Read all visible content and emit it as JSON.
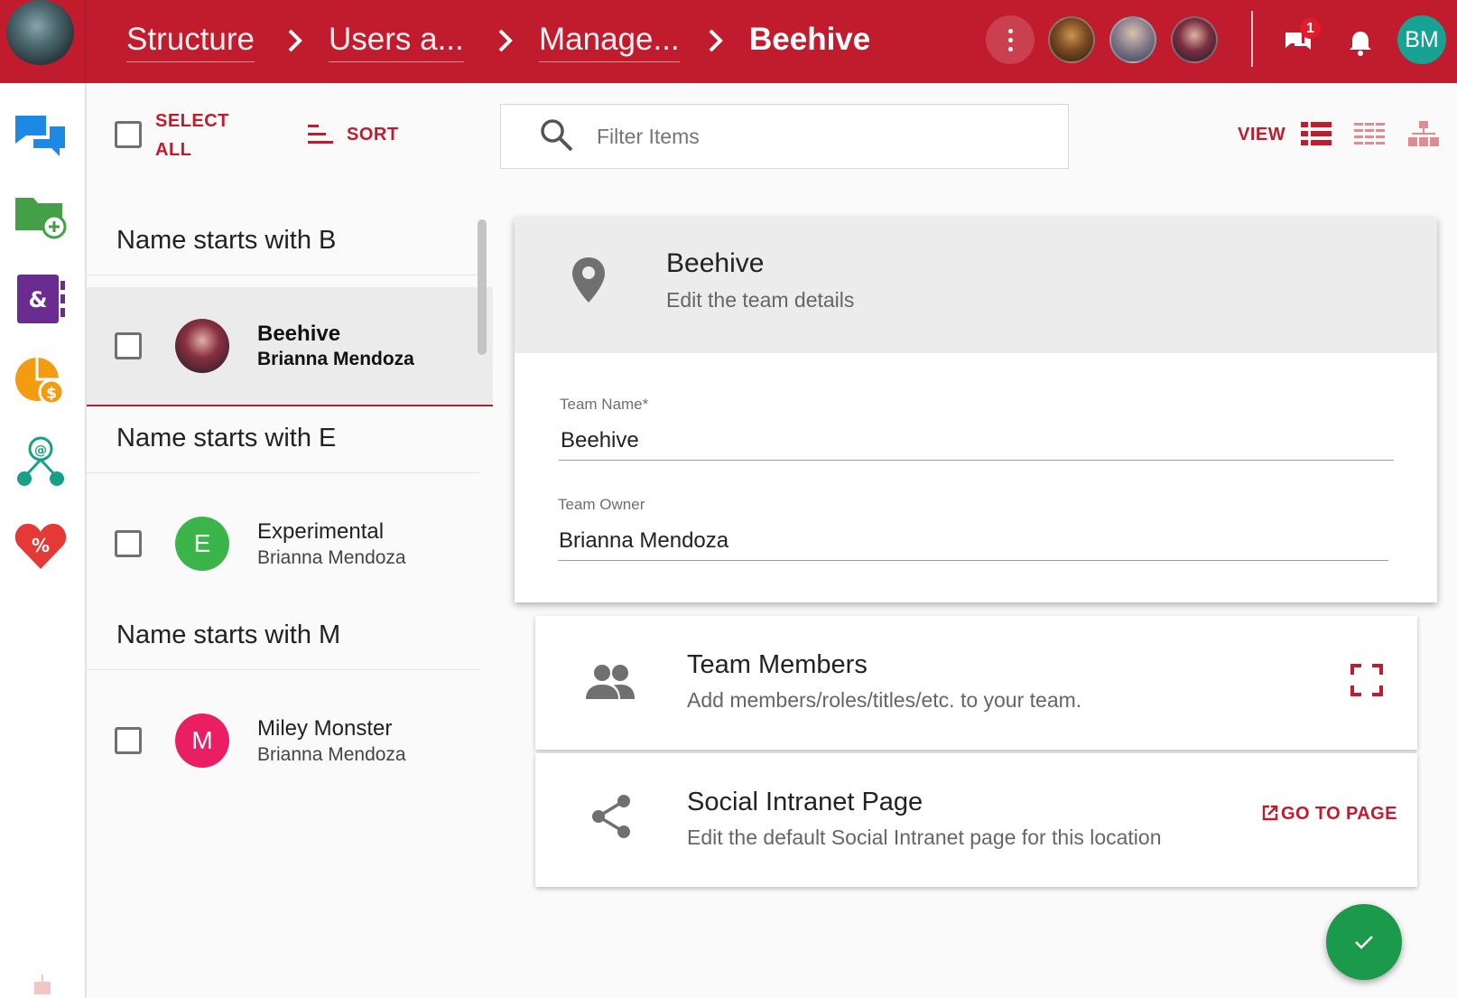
{
  "header": {
    "breadcrumbs": [
      "Structure",
      "Users a...",
      "Manage...",
      "Beehive"
    ],
    "notification_count": "1",
    "user_initials": "BM",
    "colors": {
      "brand": "#c01c2e",
      "badge": "#e51a2b",
      "user_avatar": "#17a394"
    }
  },
  "sidebar": {
    "items": [
      {
        "name": "chat-icon",
        "color": "#1e88e5"
      },
      {
        "name": "folder-add-icon",
        "color": "#43a047"
      },
      {
        "name": "address-book-icon",
        "color": "#6a2c91"
      },
      {
        "name": "pie-chart-dollar-icon",
        "color": "#f39c12"
      },
      {
        "name": "network-icon",
        "color": "#16a085"
      },
      {
        "name": "heart-percent-icon",
        "color": "#e53935"
      }
    ]
  },
  "toolbar": {
    "select_all_line1": "SELECT",
    "select_all_line2": "ALL",
    "sort_label": "SORT",
    "filter_placeholder": "Filter Items",
    "view_label": "VIEW"
  },
  "list": {
    "groups": [
      {
        "header": "Name starts with B",
        "items": [
          {
            "title": "Beehive",
            "subtitle": "Brianna Mendoza",
            "selected": true
          }
        ]
      },
      {
        "header": "Name starts with E",
        "items": [
          {
            "title": "Experimental",
            "subtitle": "Brianna Mendoza",
            "avatar_letter": "E",
            "avatar_color": "#3bb54a"
          }
        ]
      },
      {
        "header": "Name starts with M",
        "items": [
          {
            "title": "Miley Monster",
            "subtitle": "Brianna Mendoza",
            "avatar_letter": "M",
            "avatar_color": "#e91e63"
          }
        ]
      }
    ]
  },
  "detail": {
    "title": "Beehive",
    "subtitle": "Edit the team details",
    "team_name_label": "Team Name",
    "required_mark": "*",
    "team_name_value": "Beehive",
    "team_owner_label": "Team Owner",
    "team_owner_value": "Brianna Mendoza"
  },
  "members_card": {
    "title": "Team Members",
    "description": "Add members/roles/titles/etc. to your team."
  },
  "social_card": {
    "title": "Social Intranet Page",
    "description": "Edit the default Social Intranet page for this location",
    "action_label": "GO TO PAGE"
  }
}
